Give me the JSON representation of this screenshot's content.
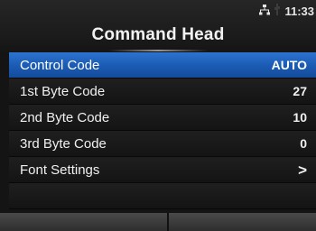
{
  "status": {
    "time": "11:33",
    "icons": [
      "network-icon",
      "usb-icon"
    ]
  },
  "header": {
    "title": "Command Head"
  },
  "menu": {
    "items": [
      {
        "label": "Control Code",
        "value": "AUTO",
        "selected": true
      },
      {
        "label": "1st Byte Code",
        "value": "27"
      },
      {
        "label": "2nd Byte Code",
        "value": "10"
      },
      {
        "label": "3rd Byte Code",
        "value": "0"
      },
      {
        "label": "Font Settings",
        "value": ">"
      }
    ]
  },
  "colors": {
    "selected": "#1c5cb5",
    "background": "#141414",
    "text": "#f0f0f0"
  }
}
